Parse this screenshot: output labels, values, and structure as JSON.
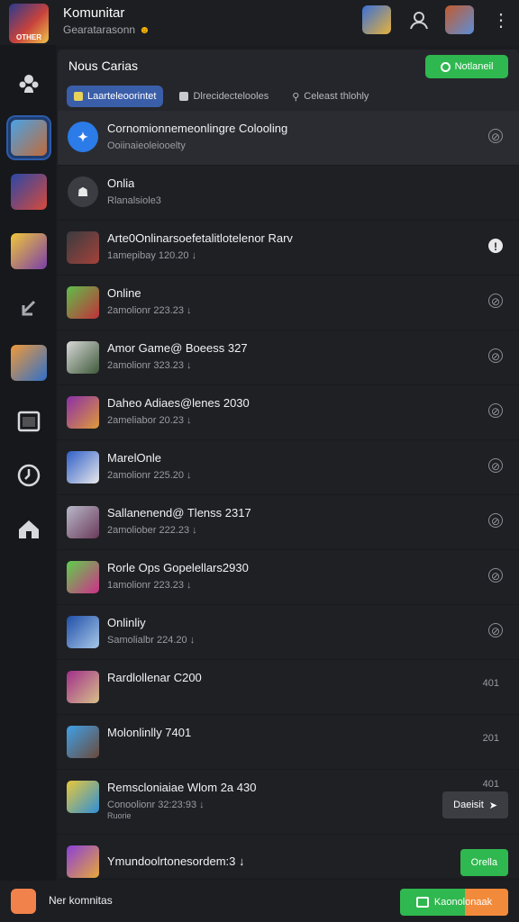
{
  "app": {
    "logo_text": "OTHER",
    "title": "Komunitar",
    "subtitle": "Gearatarasonn",
    "subtitle_emoji": "☻"
  },
  "panel": {
    "title": "Nous Carias",
    "action_button": "Notlaneil",
    "tabs": [
      {
        "label": "Laarteleoorintet",
        "active": true
      },
      {
        "label": "Dlrecidectelooles",
        "active": false
      },
      {
        "label": "Celeast thlohly",
        "active": false
      }
    ]
  },
  "rows": [
    {
      "title": "Cornomionnemeonlingre Colooling",
      "sub": "Ooiinaieoleiooelty",
      "sub2": "",
      "action": "⊘",
      "style": "selected",
      "thumb": "circle-blue"
    },
    {
      "title": "Onlia",
      "sub": "Rlanalsiole3",
      "sub2": "",
      "action": "",
      "style": "dark",
      "thumb": "circle-gray"
    },
    {
      "title": "Arte0Onlinarsoefetalitlotelenor Rarv",
      "sub": "1amepibay 120.20 ↓",
      "sub2": "",
      "action": "!",
      "style": "normal",
      "thumb": "t1"
    },
    {
      "title": "Online",
      "sub": "2amolionr 223.23 ↓",
      "sub2": "",
      "action": "⊘",
      "style": "normal",
      "thumb": "t2"
    },
    {
      "title": "Amor Game@ Boeess 327",
      "sub": "2amolionr 323.23 ↓",
      "sub2": "",
      "action": "⊘",
      "style": "normal",
      "thumb": "t3"
    },
    {
      "title": "Daheo Adiaes@lenes 2030",
      "sub": "2ameliabor 20.23 ↓",
      "sub2": "",
      "action": "⊘",
      "style": "normal",
      "thumb": "t4"
    },
    {
      "title": "MarelOnle",
      "sub": "2amolionr 225.20 ↓",
      "sub2": "",
      "action": "⊘",
      "style": "normal",
      "thumb": "t5"
    },
    {
      "title": "Sallanenend@ Tlenss 2317",
      "sub": "2amoliober 222.23 ↓",
      "sub2": "",
      "action": "⊘",
      "style": "normal",
      "thumb": "t6"
    },
    {
      "title": "Rorle Ops Gopelellars2930",
      "sub": "1amolionr 223.23 ↓",
      "sub2": "",
      "action": "⊘",
      "style": "normal",
      "thumb": "t7"
    },
    {
      "title": "Onlinliy",
      "sub": "Samolialbr 224.20 ↓",
      "sub2": "",
      "action": "⊘",
      "style": "normal",
      "thumb": "t8"
    },
    {
      "title": "Rardlollenar C200",
      "sub": "",
      "sub2": "",
      "action_num": "401",
      "style": "normal",
      "thumb": "t9"
    },
    {
      "title": "Molonlinlly 7401",
      "sub": "",
      "sub2": "",
      "action_num": "201",
      "style": "normal",
      "thumb": "t10"
    },
    {
      "title": "Remscloniaiae Wlom 2a 430",
      "sub": "Conoolionr 32:23:93 ↓",
      "sub2": "Ruorie",
      "action_num": "401",
      "badge": "Daeisit",
      "badge_style": "gray",
      "style": "normal",
      "thumb": "t11"
    },
    {
      "title": "Ymundoolrtonesordem:3 ↓",
      "sub": "",
      "sub2": "",
      "badge": "Orella",
      "badge_style": "green",
      "style": "normal",
      "thumb": "t12"
    }
  ],
  "bottom": {
    "label": "Ner komnitas",
    "button": "Kaonolonaak"
  },
  "colors": {
    "accent_blue": "#3b5ea9",
    "accent_green": "#2fb84f",
    "accent_orange": "#f28a3b"
  }
}
